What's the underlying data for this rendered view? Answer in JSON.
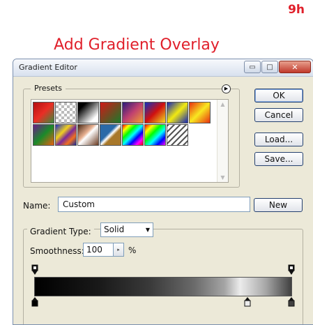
{
  "step_label": "9h",
  "heading": "Add Gradient Overlay",
  "window": {
    "title": "Gradient Editor",
    "controls": {
      "minimize": "▭",
      "maximize": "□",
      "close": "✕"
    }
  },
  "presets": {
    "label": "Presets",
    "menu_icon": "▶",
    "swatches": [
      {
        "name": "foreground-to-background",
        "css": "linear-gradient(135deg,#b20f12,#ea2e25,#3a8b3a)"
      },
      {
        "name": "foreground-to-transparent",
        "css": "repeating-conic-gradient(#bbb 0 25%,#fff 0 50%) 0 0/8px 8px"
      },
      {
        "name": "black-white",
        "css": "linear-gradient(135deg,#000 20%,#fff 80%)"
      },
      {
        "name": "red-green",
        "css": "linear-gradient(135deg,#d01818,#1a7a2a)"
      },
      {
        "name": "violet-orange",
        "css": "linear-gradient(135deg,#2a1a7a,#c04070,#f0a030)"
      },
      {
        "name": "blue-red-yellow",
        "css": "linear-gradient(135deg,#1030c0,#d01010,#f0e020)"
      },
      {
        "name": "blue-yellow-blue",
        "css": "linear-gradient(135deg,#1424b8,#f2ea10,#1424b8)"
      },
      {
        "name": "orange-yellow-orange",
        "css": "linear-gradient(135deg,#e83010,#f8e820,#e83010)"
      },
      {
        "name": "violet-green-orange",
        "css": "linear-gradient(135deg,#6a1a8a,#1a8a2a,#e86010)"
      },
      {
        "name": "yellow-violet-orange-blue",
        "css": "linear-gradient(135deg,#2030c0,#f0d020 35%,#7a2a9a 55%,#f07020 75%,#1a2a9a)"
      },
      {
        "name": "copper",
        "css": "linear-gradient(135deg,#4a2a18,#e8b090 40%,#fff 50%,#6a3a20)"
      },
      {
        "name": "chrome",
        "css": "linear-gradient(135deg,#2a6aa8 40%,#fff 50%,#a8782a 60%)"
      },
      {
        "name": "spectrum",
        "css": "linear-gradient(135deg,#f00,#ff0,#0f0,#0ff,#00f,#f0f,#f00)"
      },
      {
        "name": "transparent-rainbow",
        "css": "linear-gradient(135deg,#f00,#ff0,#0f0,#0ff,#00f,#f0f)"
      },
      {
        "name": "transparent-stripes",
        "css": "repeating-linear-gradient(135deg,#555 0 2px,#fff 2px 6px)"
      }
    ]
  },
  "buttons": {
    "ok": "OK",
    "cancel": "Cancel",
    "load": "Load...",
    "save": "Save...",
    "new": "New"
  },
  "name_field": {
    "label": "Name:",
    "value": "Custom"
  },
  "gradient_type": {
    "label": "Gradient Type:",
    "value": "Solid"
  },
  "smoothness": {
    "label": "Smoothness:",
    "value": "100",
    "unit": "%"
  },
  "gradient": {
    "opacity_stops": [
      0,
      100
    ],
    "color_stops": [
      {
        "location": 0,
        "color": "#000000"
      },
      {
        "location": 83,
        "color": "#ececec"
      },
      {
        "location": 100,
        "color": "#404040"
      }
    ]
  }
}
